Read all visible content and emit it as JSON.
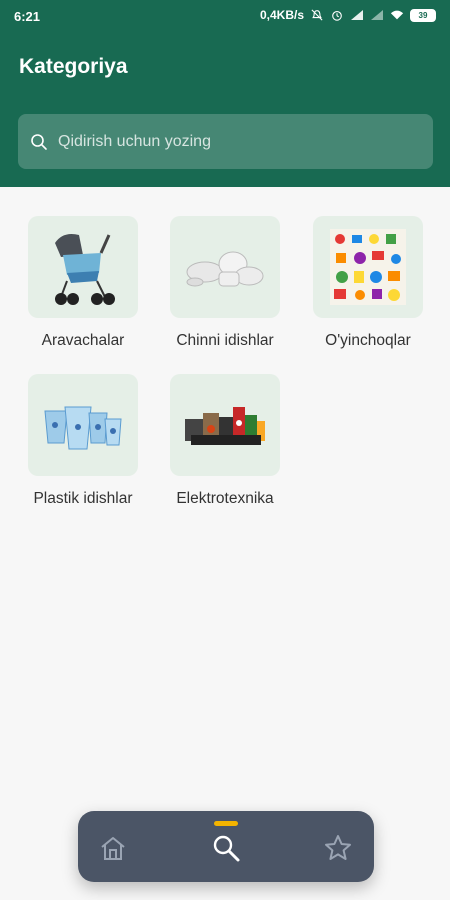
{
  "status_bar": {
    "time": "6:21",
    "speed": "0,4KB/s",
    "battery": "39"
  },
  "header": {
    "title": "Kategoriya"
  },
  "search": {
    "placeholder": "Qidirish uchun yozing"
  },
  "categories": [
    {
      "label": "Aravachalar",
      "icon": "stroller-image"
    },
    {
      "label": "Chinni idishlar",
      "icon": "porcelain-dishes-image"
    },
    {
      "label": "O'yinchoqlar",
      "icon": "toys-image"
    },
    {
      "label": "Plastik idishlar",
      "icon": "plastic-containers-image"
    },
    {
      "label": "Elektrotexnika",
      "icon": "electronics-image"
    }
  ],
  "bottom_nav": {
    "items": [
      "home-icon",
      "search-icon",
      "star-icon"
    ],
    "active": "search-icon",
    "colors": {
      "active_indicator": "#f4b400",
      "bar": "#4b5566",
      "header": "#186a52"
    }
  }
}
